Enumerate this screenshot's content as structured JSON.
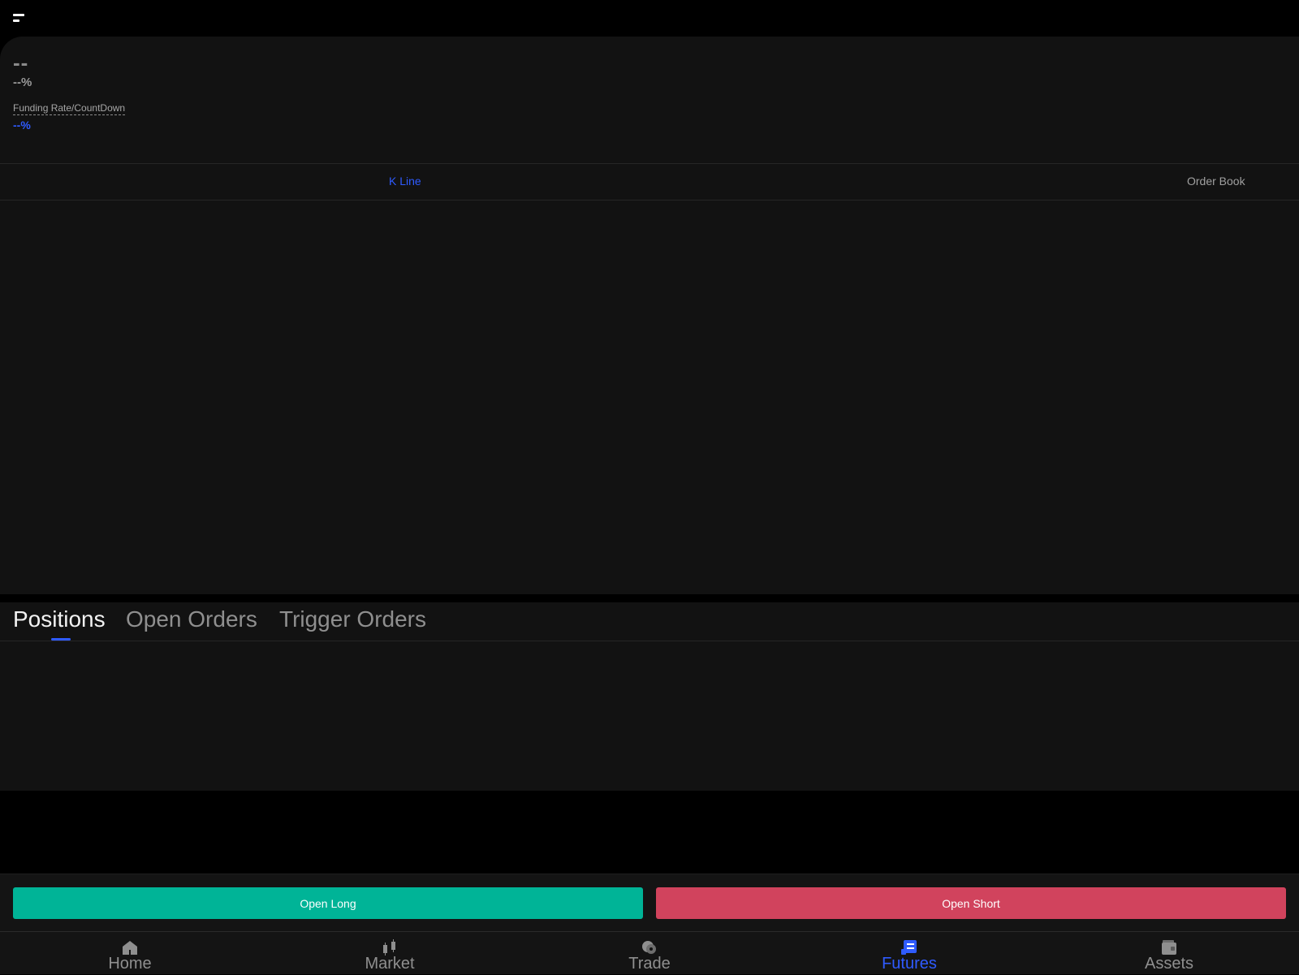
{
  "header": {
    "menu_icon": "menu-icon"
  },
  "ticker": {
    "price": "--",
    "change": "--%",
    "funding_label": "Funding Rate/CountDown",
    "funding_value": "--%"
  },
  "view_tabs": {
    "kline": "K Line",
    "order_book": "Order Book",
    "active": "kline"
  },
  "orders_tabs": {
    "positions": "Positions",
    "open_orders": "Open Orders",
    "trigger_orders": "Trigger Orders",
    "active": "positions"
  },
  "actions": {
    "open_long": "Open Long",
    "open_short": "Open Short"
  },
  "nav": {
    "items": [
      {
        "label": "Home",
        "icon": "home-icon"
      },
      {
        "label": "Market",
        "icon": "candlestick-icon"
      },
      {
        "label": "Trade",
        "icon": "trade-icon"
      },
      {
        "label": "Futures",
        "icon": "futures-icon"
      },
      {
        "label": "Assets",
        "icon": "wallet-icon"
      }
    ],
    "active": "Futures"
  },
  "colors": {
    "accent": "#2f5bff",
    "long": "#00b497",
    "short": "#d1435d",
    "panel": "#121212",
    "background": "#000000"
  }
}
